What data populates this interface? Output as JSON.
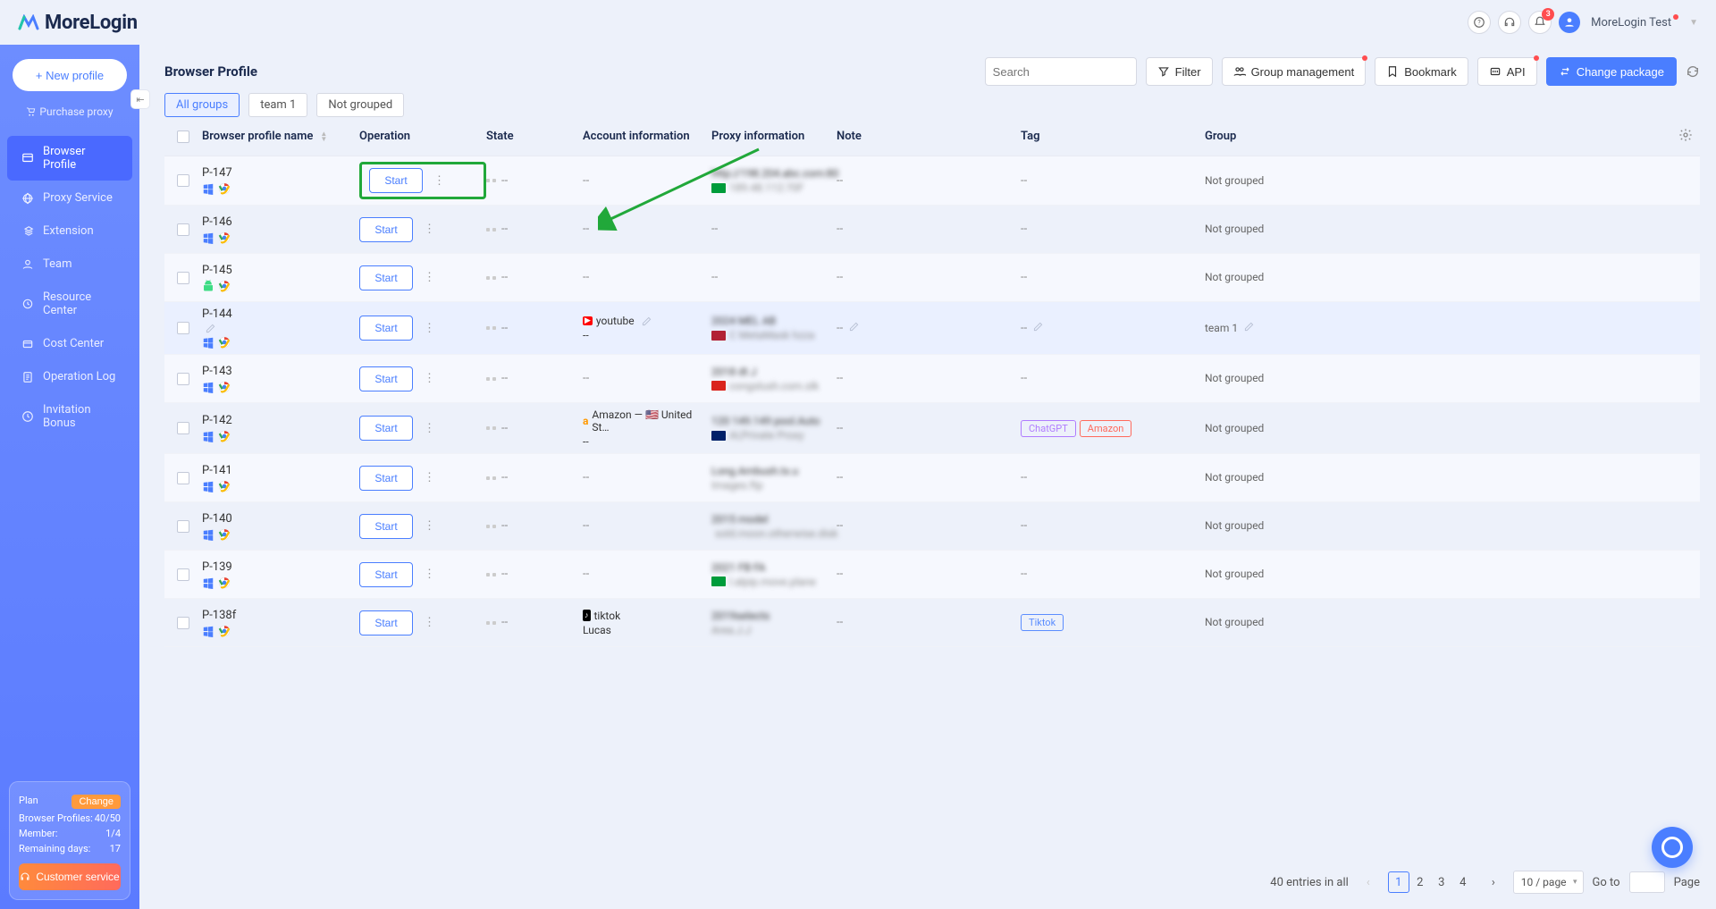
{
  "app_name": "MoreLogin",
  "user": {
    "name": "MoreLogin Test",
    "notif_count": "3"
  },
  "sidebar": {
    "new_profile_label": "+ New profile",
    "purchase_proxy_label": "Purchase proxy",
    "items": [
      {
        "label": "Browser Profile",
        "active": true
      },
      {
        "label": "Proxy Service",
        "active": false
      },
      {
        "label": "Extension",
        "active": false
      },
      {
        "label": "Team",
        "active": false
      },
      {
        "label": "Resource Center",
        "active": false
      },
      {
        "label": "Cost Center",
        "active": false
      },
      {
        "label": "Operation Log",
        "active": false
      },
      {
        "label": "Invitation Bonus",
        "active": false
      }
    ],
    "plan": {
      "plan_label": "Plan",
      "change_label": "Change",
      "profiles_label": "Browser Profiles:",
      "profiles_val": "40/50",
      "member_label": "Member:",
      "member_val": "1/4",
      "remain_label": "Remaining days:",
      "remain_val": "17",
      "cs_label": "Customer service"
    }
  },
  "page": {
    "title": "Browser Profile",
    "search_placeholder": "Search",
    "filter_label": "Filter",
    "group_mgmt_label": "Group management",
    "bookmark_label": "Bookmark",
    "api_label": "API",
    "change_pkg_label": "Change package"
  },
  "group_tabs": [
    {
      "label": "All groups",
      "active": true
    },
    {
      "label": "team 1",
      "active": false
    },
    {
      "label": "Not grouped",
      "active": false
    }
  ],
  "columns": {
    "name": "Browser profile name",
    "operation": "Operation",
    "state": "State",
    "account": "Account information",
    "proxy": "Proxy information",
    "note": "Note",
    "tag": "Tag",
    "group": "Group"
  },
  "start_label": "Start",
  "rows": [
    {
      "name": "P-147",
      "os": "win",
      "highlight": true,
      "account": "--",
      "account2": "",
      "proxy1": "http://198.204.abc.com:80",
      "proxy2": "189.48.112:70F",
      "flag": "br",
      "tags": [],
      "group": "Not grouped",
      "sel": false
    },
    {
      "name": "P-146",
      "os": "win",
      "account": "--",
      "account2": "",
      "proxy1": "--",
      "proxy2": "",
      "flag": "",
      "tags": [],
      "group": "Not grouped",
      "sel": false
    },
    {
      "name": "P-145",
      "os": "and",
      "account": "--",
      "account2": "",
      "proxy1": "--",
      "proxy2": "",
      "flag": "",
      "tags": [],
      "group": "Not grouped",
      "sel": false
    },
    {
      "name": "P-144",
      "os": "win",
      "account": "youtube",
      "account_icon": "yt",
      "account2": "--",
      "proxy1": "2024 MEL AB",
      "proxy2": "C MetaMask hzza",
      "flag": "us",
      "tags": [],
      "group": "team 1",
      "sel": true,
      "note_edit": true
    },
    {
      "name": "P-143",
      "os": "win",
      "account": "--",
      "account2": "",
      "proxy1": "2018 dt J",
      "proxy2": "congslush.com.slk",
      "flag": "vn",
      "tags": [],
      "group": "Not grouped",
      "sel": false
    },
    {
      "name": "P-142",
      "os": "win",
      "account": "Amazon — 🇺🇸 United St…",
      "account_icon": "amz",
      "account2": "--",
      "proxy1": "120 149.149 pool.Auto",
      "proxy2": "AI,Private Proxy",
      "flag": "au",
      "tags": [
        {
          "text": "ChatGPT",
          "color": "#b07cff"
        },
        {
          "text": "Amazon",
          "color": "#ff6a5c"
        }
      ],
      "group": "Not grouped",
      "sel": false
    },
    {
      "name": "P-141",
      "os": "win",
      "account": "--",
      "account2": "",
      "proxy1": "Long.Ambush.tx.u",
      "proxy2": "Images.ftp",
      "flag": "",
      "tags": [],
      "group": "Not grouped",
      "sel": false
    },
    {
      "name": "P-140",
      "os": "win",
      "account": "--",
      "account2": "",
      "proxy1": "2015 model",
      "proxy2": "sold.moon.otherwise.disk",
      "flag": "jp",
      "tags": [],
      "group": "Not grouped",
      "sel": false
    },
    {
      "name": "P-139",
      "os": "win",
      "account": "--",
      "account2": "",
      "proxy1": "2021 FB FA",
      "proxy2": "l.alpip.move.plane",
      "flag": "br",
      "tags": [],
      "group": "Not grouped",
      "sel": false
    },
    {
      "name": "P-138f",
      "os": "win",
      "account": "tiktok",
      "account_icon": "tt",
      "account2": "Lucas",
      "proxy1": "2019selects",
      "proxy2": "Area.J.J",
      "flag": "",
      "tags": [
        {
          "text": "Tiktok",
          "color": "#5b8dff"
        }
      ],
      "group": "Not grouped",
      "sel": false
    }
  ],
  "pager": {
    "total": "40 entries in all",
    "pages": [
      "1",
      "2",
      "3",
      "4"
    ],
    "current": "1",
    "per_page": "10 / page",
    "goto_label": "Go to",
    "page_label": "Page"
  },
  "flags": {
    "br": "linear-gradient(#009c3b 0 100%)",
    "us": "linear-gradient(#b22234 0 100%)",
    "vn": "linear-gradient(#da251d 0 100%)",
    "au": "linear-gradient(#012169 0 100%)",
    "jp": "radial-gradient(circle at 50% 50%, #bc002d 0 30%, #fff 31% 100%)"
  }
}
